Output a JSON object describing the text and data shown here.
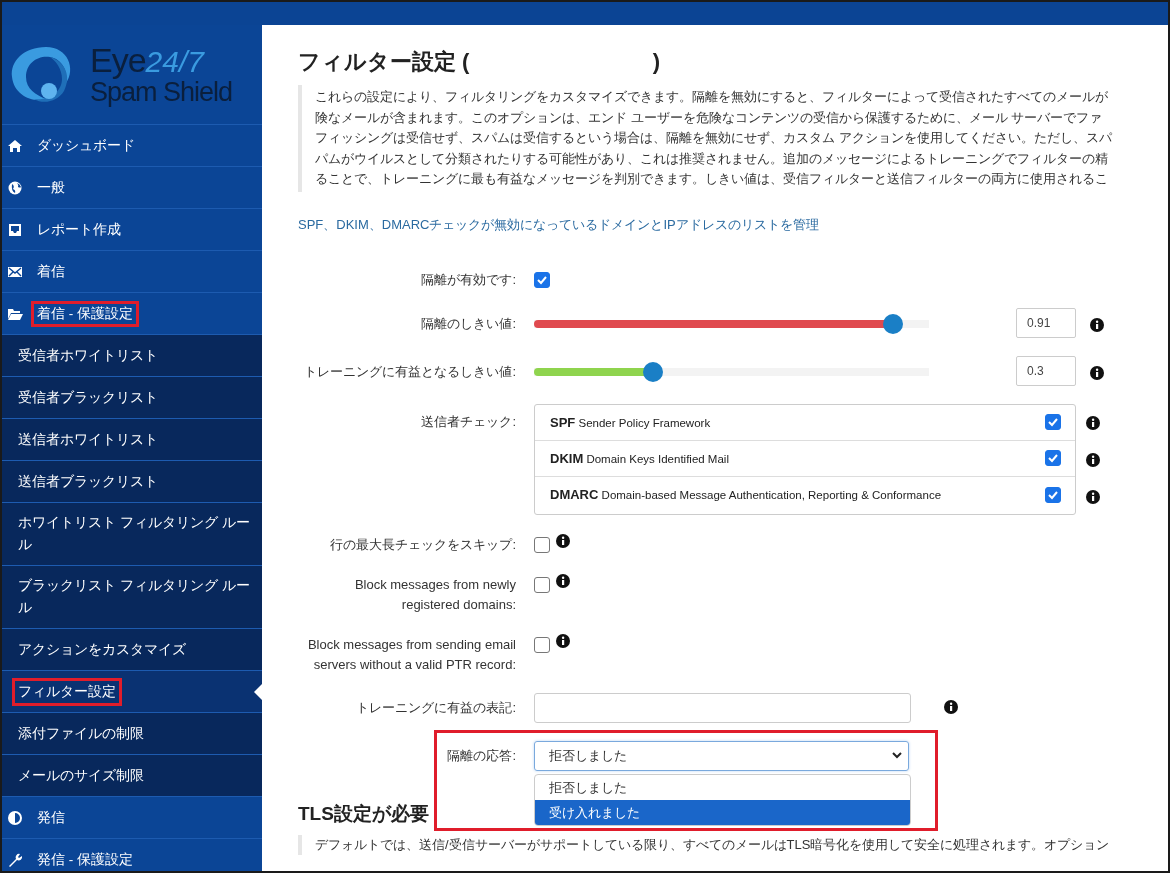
{
  "logo": {
    "word": "Eye",
    "accent": "24/7",
    "tagline": "Spam Shield"
  },
  "sidebar": {
    "items": [
      {
        "label": "ダッシュボード",
        "highlighted": false
      },
      {
        "label": "一般",
        "highlighted": false
      },
      {
        "label": "レポート作成",
        "highlighted": false
      },
      {
        "label": "着信",
        "highlighted": false
      },
      {
        "label": "着信 - 保護設定",
        "highlighted": true,
        "expanded": true,
        "children": [
          {
            "label": "受信者ホワイトリスト",
            "selected": false,
            "highlighted": false
          },
          {
            "label": "受信者ブラックリスト",
            "selected": false,
            "highlighted": false
          },
          {
            "label": "送信者ホワイトリスト",
            "selected": false,
            "highlighted": false
          },
          {
            "label": "送信者ブラックリスト",
            "selected": false,
            "highlighted": false
          },
          {
            "label": "ホワイトリスト フィルタリング ルール",
            "selected": false,
            "highlighted": false
          },
          {
            "label": "ブラックリスト フィルタリング ルール",
            "selected": false,
            "highlighted": false
          },
          {
            "label": "アクションをカスタマイズ",
            "selected": false,
            "highlighted": false
          },
          {
            "label": "フィルター設定",
            "selected": true,
            "highlighted": true
          },
          {
            "label": "添付ファイルの制限",
            "selected": false,
            "highlighted": false
          },
          {
            "label": "メールのサイズ制限",
            "selected": false,
            "highlighted": false
          }
        ]
      },
      {
        "label": "発信",
        "highlighted": false
      },
      {
        "label": "発信 - 保護設定",
        "highlighted": false
      }
    ]
  },
  "main": {
    "title": "フィルター設定 (                              )",
    "description": [
      "これらの設定により、フィルタリングをカスタマイズできます。隔離を無効にすると、フィルターによって受信されたすべてのメールが",
      "険なメールが含まれます。このオプションは、エンド ユーザーを危険なコンテンツの受信から保護するために、メール サーバーでファ",
      "フィッシングは受信せず、スパムは受信するという場合は、隔離を無効にせず、カスタム アクションを使用してください。ただし、スパ",
      "パムがウイルスとして分類されたりする可能性があり、これは推奨されません。追加のメッセージによるトレーニングでフィルターの精",
      "ることで、トレーニングに最も有益なメッセージを判別できます。しきい値は、受信フィルターと送信フィルターの両方に使用されるこ"
    ],
    "link": "SPF、DKIM、DMARCチェックが無効になっているドメインとIPアドレスのリストを管理",
    "form": [
      {
        "kind": "checkbox",
        "label": "隔離が有効です:",
        "checked": true
      },
      {
        "kind": "slider",
        "label": "隔離のしきい値:",
        "level": 0.91,
        "value": "0.91",
        "color": "#e04a4f",
        "info": true
      },
      {
        "kind": "slider",
        "label": "トレーニングに有益となるしきい値:",
        "level": 0.3,
        "value": "0.3",
        "color": "#8fd44e",
        "info": true
      },
      {
        "kind": "checkgroup",
        "label": "送信者チェック:",
        "options": [
          {
            "label": "**SPF** Sender Policy Framework",
            "checked": true
          },
          {
            "label": "**DKIM** Domain Keys Identified Mail",
            "checked": true
          },
          {
            "label": "**DMARC** Domain-based Message Authentication, Reporting & Conformance",
            "checked": true
          }
        ]
      },
      {
        "kind": "checkbox",
        "label": "行の最大長チェックをスキップ:",
        "checked": false,
        "info": true
      },
      {
        "kind": "checkbox",
        "label": "Block messages from newly registered domains:",
        "checked": false,
        "info": true
      },
      {
        "kind": "checkbox",
        "label": "Block messages from sending email servers without a valid PTR record:",
        "checked": false,
        "info": true
      },
      {
        "kind": "text",
        "label": "トレーニングに有益の表記:",
        "info": true
      },
      {
        "kind": "select",
        "label": "隔離の応答:",
        "value": "拒否しました",
        "open": true,
        "highlighted": true,
        "options": [
          {
            "label": "拒否しました",
            "highlighted": false
          },
          {
            "label": "受け入れました",
            "highlighted": true
          }
        ]
      }
    ],
    "section": {
      "heading": "TLS設定が必要",
      "description": "デフォルトでは、送信/受信サーバーがサポートしている限り、すべてのメールはTLS暗号化を使用して安全に処理されます。オプション"
    }
  }
}
